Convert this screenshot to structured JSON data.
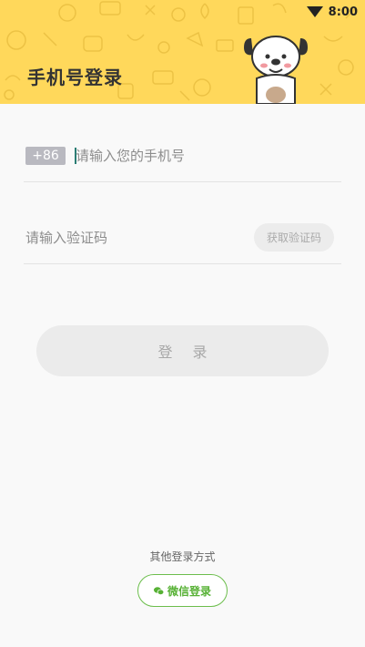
{
  "status_bar": {
    "time": "8:00"
  },
  "header": {
    "title": "手机号登录"
  },
  "phone": {
    "country_code": "+86",
    "placeholder": "请输入您的手机号",
    "value": ""
  },
  "code": {
    "placeholder": "请输入验证码",
    "value": "",
    "get_code_label": "获取验证码"
  },
  "login_button": {
    "label": "登录"
  },
  "other_login": {
    "label": "其他登录方式",
    "wechat_label": "微信登录"
  },
  "colors": {
    "header_bg": "#ffd85b",
    "accent_green": "#57b135",
    "disabled_button_bg": "#ebebeb"
  }
}
